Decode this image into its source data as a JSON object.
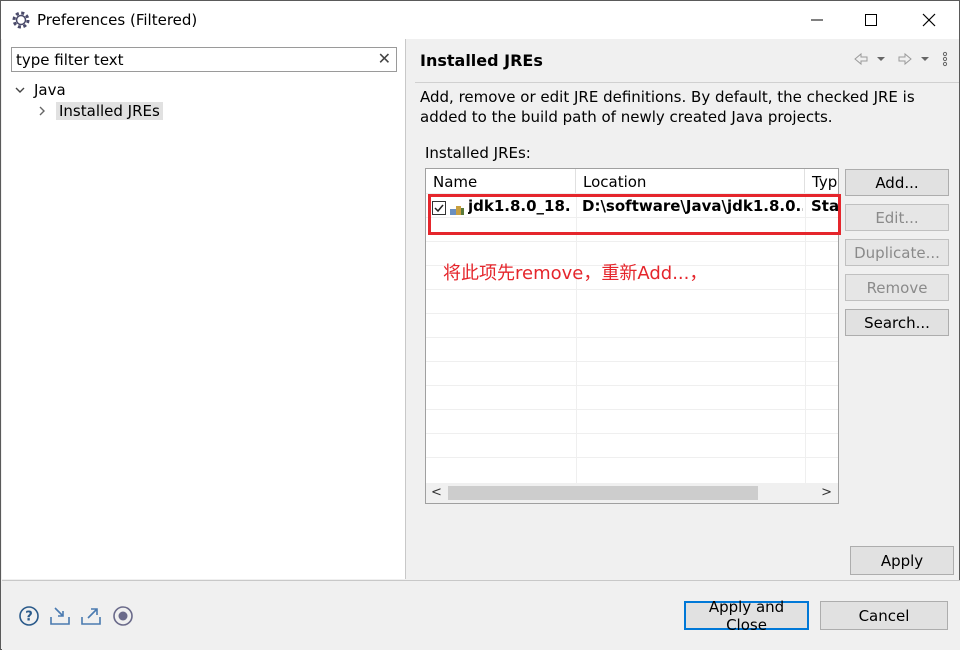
{
  "window": {
    "title": "Preferences (Filtered)",
    "icon": "gear-icon"
  },
  "left": {
    "filter_text": "type filter text",
    "tree": [
      {
        "label": "Java",
        "expanded": true
      },
      {
        "label": "Installed JREs",
        "selected": true
      }
    ]
  },
  "page": {
    "title": "Installed JREs",
    "description": "Add, remove or edit JRE definitions. By default, the checked JRE is added to the build path of newly created Java projects.",
    "table_label": "Installed JREs:",
    "columns": [
      "Name",
      "Location",
      "Typ"
    ],
    "rows": [
      {
        "checked": true,
        "name": "jdk1.8.0_18...",
        "location": "D:\\software\\Java\\jdk1.8.0...",
        "type": "Star"
      }
    ]
  },
  "annotation": {
    "text": "将此项先remove，重新Add...，",
    "color": "#e5262c"
  },
  "buttons": {
    "add": "Add...",
    "edit": "Edit...",
    "duplicate": "Duplicate...",
    "remove": "Remove",
    "search": "Search...",
    "apply": "Apply",
    "apply_close": "Apply and Close",
    "cancel": "Cancel"
  },
  "colors": {
    "accent": "#0078d7",
    "annotation_red": "#e5262c"
  }
}
